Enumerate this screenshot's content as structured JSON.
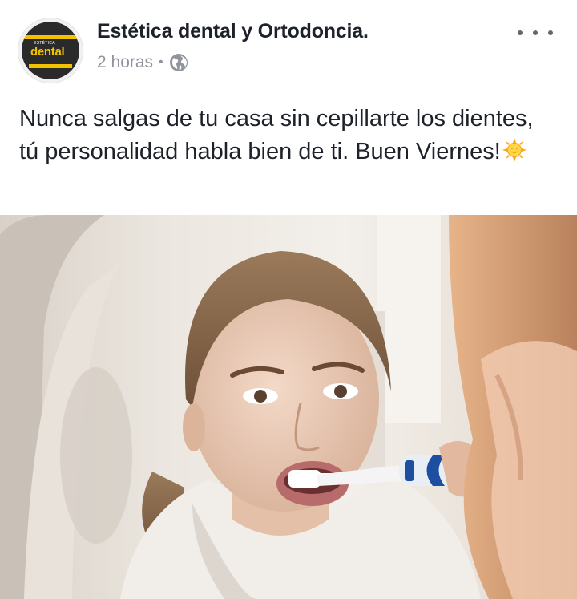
{
  "post": {
    "page_name": "Estética dental y Ortodoncia.",
    "timestamp": "2 horas",
    "separator": "•",
    "audience_icon": "globe-icon",
    "more_icon": "more-options-icon",
    "text": "Nunca salgas de tu casa sin cepillarte los dientes, tú personalidad habla bien de ti. Buen Viernes!",
    "emoji": "sun-emoji"
  },
  "avatar": {
    "logo_small": "ESTÉTICA",
    "logo_main": "dental",
    "brand_color": "#f2c200",
    "background_color": "#2a2a2a"
  },
  "photo": {
    "subject": "woman-brushing-teeth-photo"
  },
  "colors": {
    "title": "#1d2129",
    "meta": "#90949c",
    "icon": "#606770"
  }
}
